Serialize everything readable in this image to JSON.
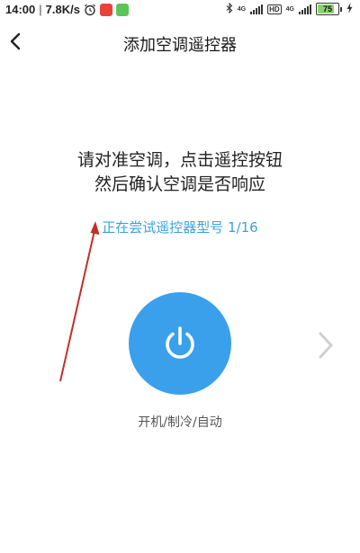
{
  "status_bar": {
    "time": "14:00",
    "separator": "|",
    "net_speed": "7.8K/s",
    "icons": [
      "alarm-icon",
      "app-badge-red",
      "app-badge-green",
      "bluetooth-icon",
      "signal-4g-icon",
      "hd-icon",
      "battery-icon",
      "charging-icon"
    ],
    "net_label_1": "4G",
    "net_label_2": "4G",
    "hd_label": "HD",
    "battery_level": "75",
    "colors": {
      "badge_red": "#e8423a",
      "badge_green": "#5cc45a",
      "battery_fill": "#8bd46a"
    }
  },
  "nav": {
    "title": "添加空调遥控器",
    "back_icon": "chevron-left-icon"
  },
  "instructions": {
    "line1": "请对准空调，点击遥控按钮",
    "line2": "然后确认空调是否响应"
  },
  "progress": {
    "text": "正在尝试遥控器型号 1/16"
  },
  "power": {
    "icon": "power-icon",
    "label": "开机/制冷/自动",
    "color": "#3aa0ec"
  },
  "next": {
    "icon": "chevron-right-icon"
  },
  "annotation": {
    "color": "#c0302b"
  }
}
